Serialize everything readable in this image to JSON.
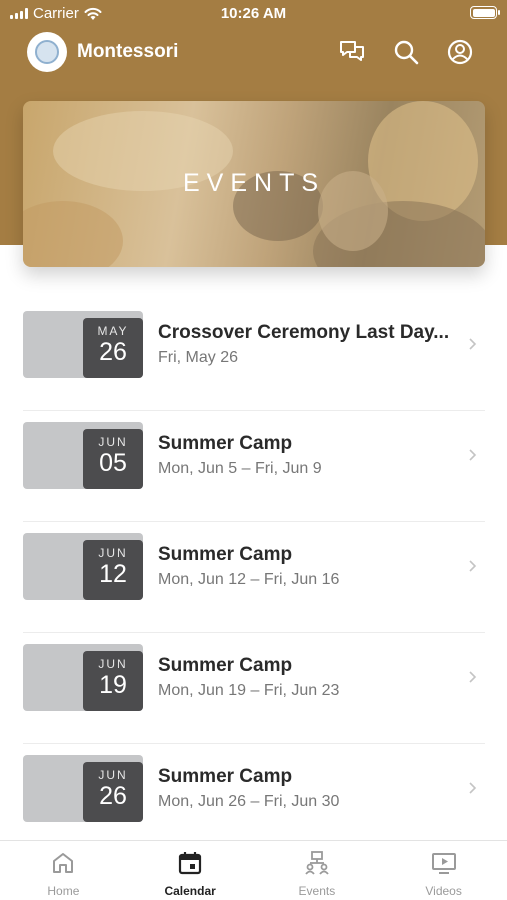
{
  "status_bar": {
    "carrier": "Carrier",
    "time": "10:26 AM"
  },
  "app_bar": {
    "title": "Montessori",
    "icons": [
      "chat-icon",
      "search-icon",
      "account-icon"
    ]
  },
  "banner": {
    "title": "EVENTS"
  },
  "events": [
    {
      "month": "MAY",
      "day": "26",
      "title": "Crossover Ceremony Last Day...",
      "date": "Fri, May 26"
    },
    {
      "month": "JUN",
      "day": "05",
      "title": "Summer Camp",
      "date": "Mon, Jun 5 – Fri, Jun 9"
    },
    {
      "month": "JUN",
      "day": "12",
      "title": "Summer Camp",
      "date": "Mon, Jun 12 – Fri, Jun 16"
    },
    {
      "month": "JUN",
      "day": "19",
      "title": "Summer Camp",
      "date": "Mon, Jun 19 – Fri, Jun 23"
    },
    {
      "month": "JUN",
      "day": "26",
      "title": "Summer Camp",
      "date": "Mon, Jun 26 – Fri, Jun 30"
    }
  ],
  "tab_bar": {
    "tabs": [
      {
        "label": "Home",
        "icon": "home-icon"
      },
      {
        "label": "Calendar",
        "icon": "calendar-icon",
        "active": true
      },
      {
        "label": "Events",
        "icon": "events-icon"
      },
      {
        "label": "Videos",
        "icon": "videos-icon"
      }
    ]
  },
  "colors": {
    "brand": "#a47d43",
    "date_box": "#4c4c4e",
    "date_card": "#c5c6c8"
  }
}
